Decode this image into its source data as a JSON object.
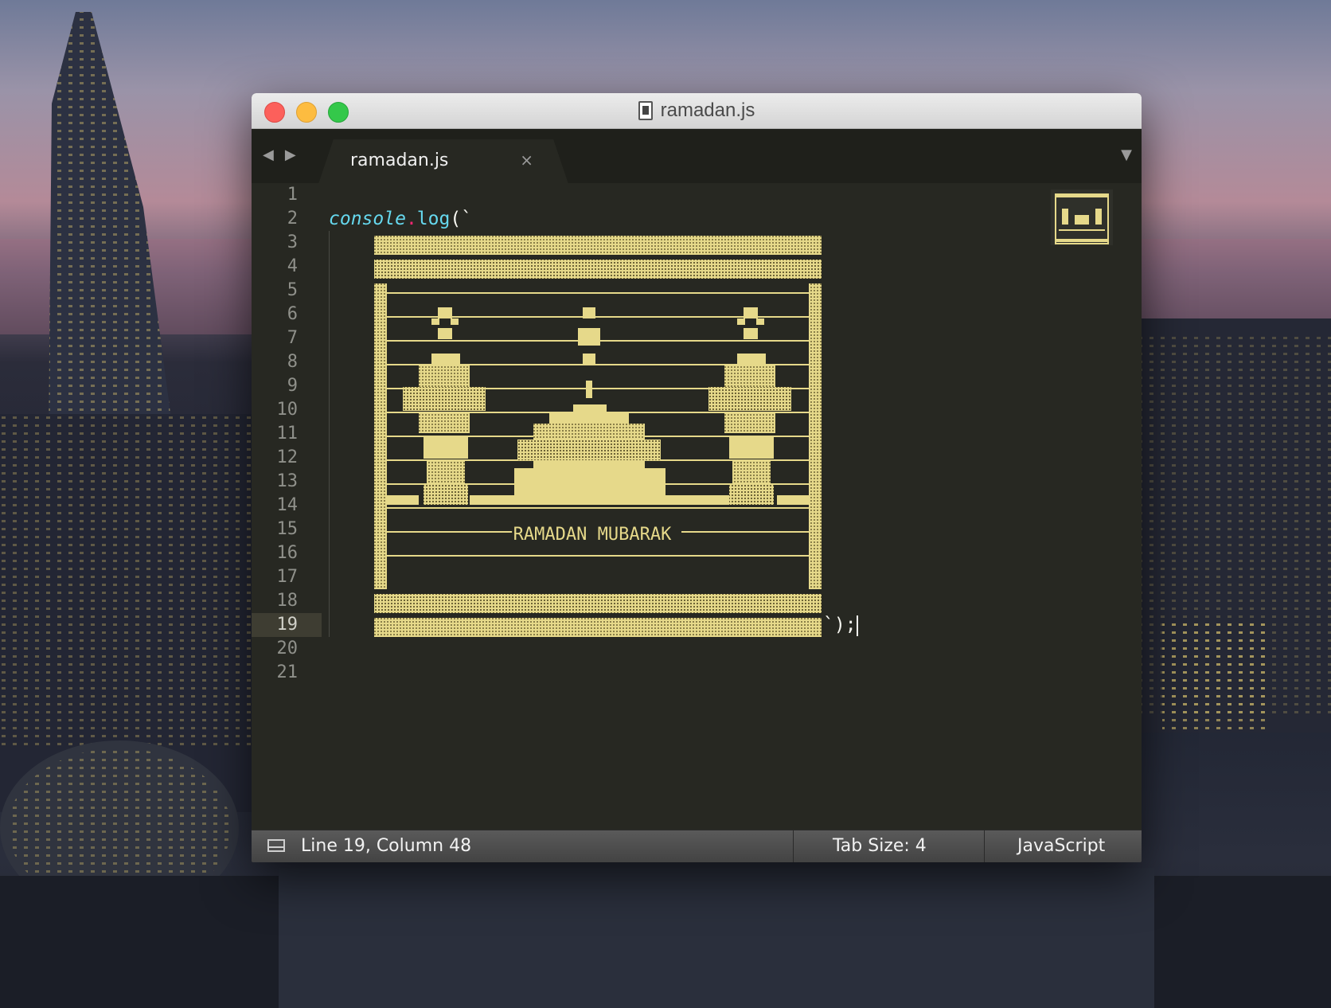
{
  "window": {
    "title": "ramadan.js"
  },
  "tabs": [
    {
      "label": "ramadan.js",
      "close_glyph": "×"
    }
  ],
  "nav": {
    "back_glyph": "◀",
    "forward_glyph": "▶",
    "menu_glyph": "▼"
  },
  "gutter": {
    "line_numbers": [
      "1",
      "2",
      "3",
      "4",
      "5",
      "6",
      "7",
      "8",
      "9",
      "10",
      "11",
      "12",
      "13",
      "14",
      "15",
      "16",
      "17",
      "18",
      "19",
      "20",
      "21"
    ],
    "active_line": "19"
  },
  "code": {
    "line2": {
      "object": "console",
      "dot": ".",
      "method": "log",
      "open": "(`"
    },
    "art_text": "RAMADAN MUBARAK",
    "line19_tail": "`);"
  },
  "statusbar": {
    "position": "Line 19, Column 48",
    "tab_size": "Tab Size: 4",
    "syntax": "JavaScript"
  },
  "colors": {
    "art": "#e6d98a",
    "editor_bg": "#272822",
    "keyword": "#66d9ef",
    "operator": "#f92672"
  },
  "icons": [
    "file-icon",
    "panel-icon",
    "close-icon",
    "chevron-left-icon",
    "chevron-right-icon",
    "dropdown-icon"
  ]
}
